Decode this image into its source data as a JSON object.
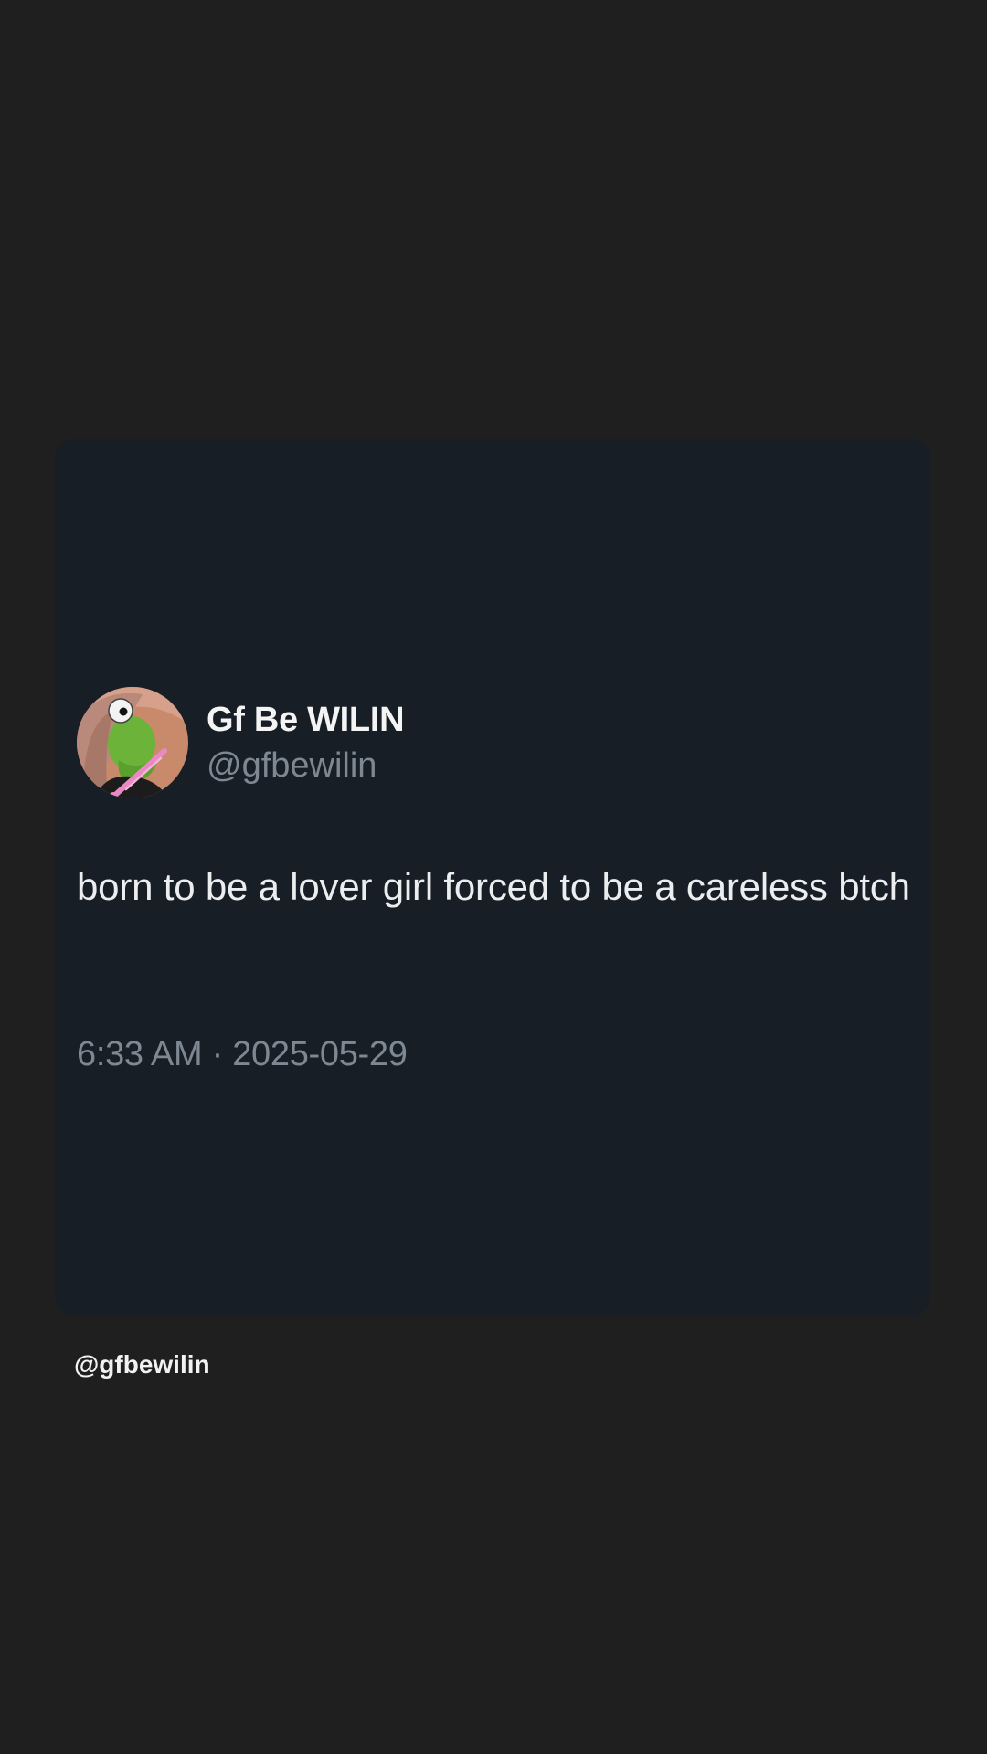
{
  "tweet": {
    "author": {
      "display_name": "Gf Be WILIN",
      "handle": "@gfbewilin",
      "avatar_icon": "kermit-avatar-icon"
    },
    "text": "born to be a lover girl forced to be a careless btch",
    "timestamp": "6:33 AM · 2025-05-29"
  },
  "watermark": "@gfbewilin",
  "colors": {
    "page_background": "#1f1f1f",
    "card_background": "#171e26",
    "primary_text": "#ecedef",
    "secondary_text": "#7d8893"
  }
}
